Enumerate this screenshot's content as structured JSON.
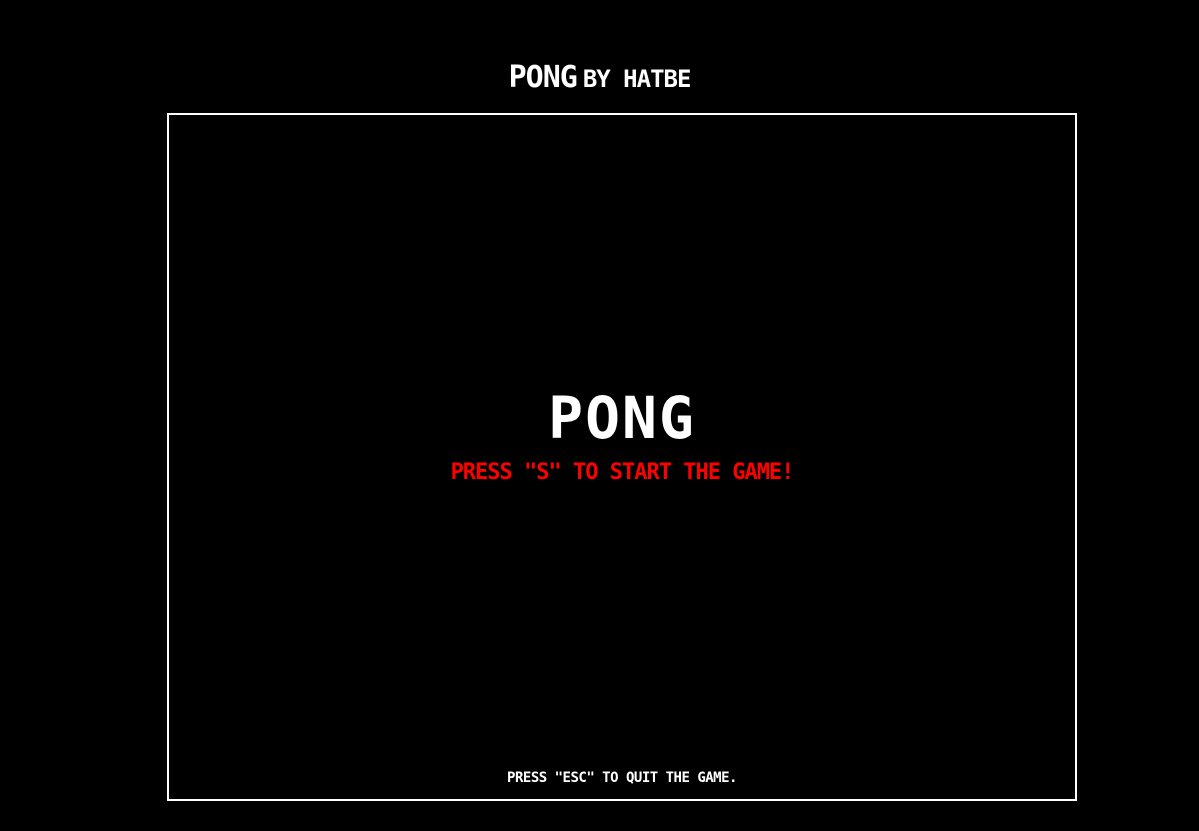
{
  "header": {
    "title": "PONG",
    "byline": "BY HATBE"
  },
  "game": {
    "title": "PONG",
    "start_prompt": "PRESS \"S\" TO START THE GAME!",
    "quit_prompt": "PRESS \"ESC\" TO QUIT THE GAME."
  },
  "colors": {
    "background": "#000000",
    "text": "#ffffff",
    "accent": "#ff0000",
    "frame_border": "#ffffff"
  }
}
